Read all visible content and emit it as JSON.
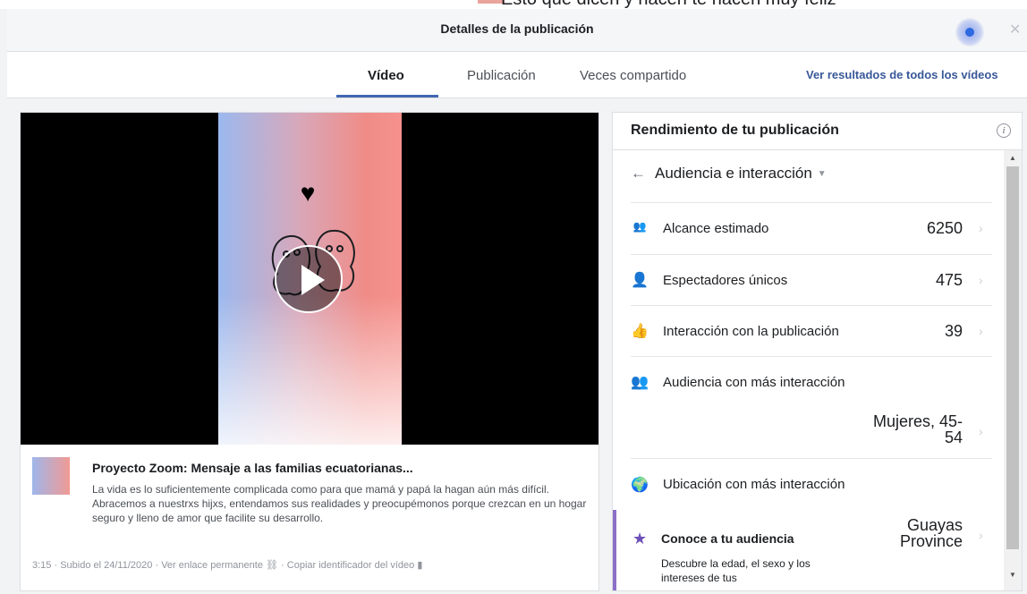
{
  "background_page": {
    "partial_text": "Esto que dicen y hacen te hacen muy feliz"
  },
  "header": {
    "title": "Detalles de la publicación",
    "close_icon": "close-icon"
  },
  "tabs": {
    "items": [
      {
        "label": "Vídeo",
        "active": true
      },
      {
        "label": "Publicación",
        "active": false
      },
      {
        "label": "Veces compartido",
        "active": false
      }
    ],
    "right_link": "Ver resultados de todos los vídeos"
  },
  "video": {
    "title": "Proyecto Zoom: Mensaje a las familias ecuatorianas...",
    "description": "La vida es lo suficientemente complicada como para que mamá y papá la hagan aún más difícil. Abracemos a nuestrxs hijxs, entendamos sus realidades y preocupémonos porque crezcan en un hogar seguro y lleno de amor que facilite su desarrollo.",
    "meta": {
      "duration": "3:15",
      "uploaded": "Subido el 24/11/2020",
      "permalink": "Ver enlace permanente",
      "copy_id": "Copiar identificador del vídeo"
    }
  },
  "performance": {
    "title": "Rendimiento de tu publicación",
    "info_icon": "i",
    "section": "Audiencia e interacción",
    "rows": [
      {
        "icon": "group-icon",
        "label": "Alcance estimado",
        "value": "6250"
      },
      {
        "icon": "person-icon",
        "label": "Espectadores únicos",
        "value": "475"
      },
      {
        "icon": "thumbs-up-icon",
        "label": "Interacción con la publicación",
        "value": "39"
      },
      {
        "icon": "people-icon",
        "label": "Audiencia con más interacción",
        "value": "Mujeres, 45-54"
      },
      {
        "icon": "globe-icon",
        "label": "Ubicación con más interacción",
        "value": "Guayas Province"
      }
    ],
    "know_audience": {
      "title": "Conoce a tu audiencia",
      "description": "Descubre la edad, el sexo y los intereses de tus"
    }
  },
  "colors": {
    "accent": "#4267b2",
    "link": "#385898",
    "purple": "#8c6fc7"
  }
}
